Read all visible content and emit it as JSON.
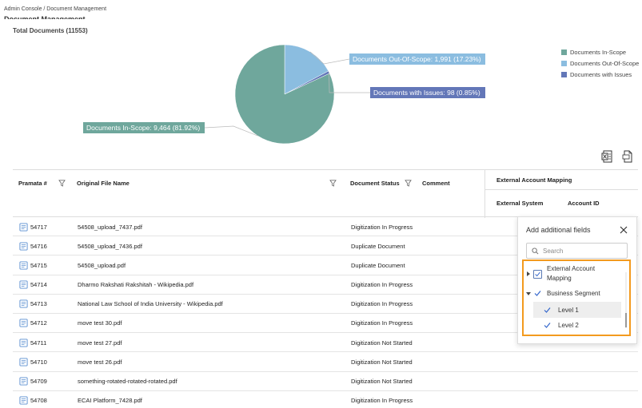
{
  "breadcrumb": "Admin Console / Document Management",
  "page_title": "Document Management",
  "chart_data": {
    "type": "pie",
    "title": "Total Documents (11553)",
    "labels": [
      "Documents In-Scope",
      "Documents Out-Of-Scope",
      "Documents with Issues"
    ],
    "values": [
      9464,
      1991,
      98
    ],
    "percents": [
      81.92,
      17.23,
      0.85
    ],
    "colors": [
      "#6fa79c",
      "#8bbde0",
      "#6377b8"
    ],
    "callouts": [
      "Documents In-Scope: 9,464 (81.92%)",
      "Documents Out-Of-Scope: 1,991 (17.23%)",
      "Documents with Issues: 98 (0.85%)"
    ],
    "legend_placement": "top-right"
  },
  "table": {
    "columns": {
      "id": "Pramata #",
      "file": "Original File Name",
      "status": "Document Status",
      "comment": "Comment",
      "ext_map": "External Account Mapping",
      "ext_system": "External System",
      "account_id": "Account ID"
    },
    "rows": [
      {
        "id": "54717",
        "file": "54508_upload_7437.pdf",
        "status": "Digitization In Progress"
      },
      {
        "id": "54716",
        "file": "54508_upload_7436.pdf",
        "status": "Duplicate Document"
      },
      {
        "id": "54715",
        "file": "54508_upload.pdf",
        "status": "Duplicate Document"
      },
      {
        "id": "54714",
        "file": "Dharmo Rakshati Rakshitah - Wikipedia.pdf",
        "status": "Digitization In Progress"
      },
      {
        "id": "54713",
        "file": "National Law School of India University - Wikipedia.pdf",
        "status": "Digitization In Progress"
      },
      {
        "id": "54712",
        "file": "move test 30.pdf",
        "status": "Digitization In Progress"
      },
      {
        "id": "54711",
        "file": "move test 27.pdf",
        "status": "Digitization Not Started"
      },
      {
        "id": "54710",
        "file": "move test 26.pdf",
        "status": "Digitization Not Started"
      },
      {
        "id": "54709",
        "file": "something-rotated-rotated-rotated.pdf",
        "status": "Digitization Not Started"
      },
      {
        "id": "54708",
        "file": "ECAI Platform_7428.pdf",
        "status": "Digitization In Progress"
      }
    ]
  },
  "popup": {
    "title": "Add additional fields",
    "search_placeholder": "Search",
    "items": [
      {
        "label": "External Account Mapping",
        "label_line1": "External Account",
        "label_line2": "Mapping",
        "checked": true,
        "expanded": false
      },
      {
        "label": "Business Segment",
        "checked": true,
        "expanded": true
      },
      {
        "label": "Level 1",
        "checked": true
      },
      {
        "label": "Level 2",
        "checked": true
      }
    ]
  },
  "icons": {
    "export_excel": "excel-export-icon",
    "export_pdf": "pdf-export-icon",
    "filter": "filter-icon",
    "close": "close-icon",
    "search": "search-icon"
  }
}
